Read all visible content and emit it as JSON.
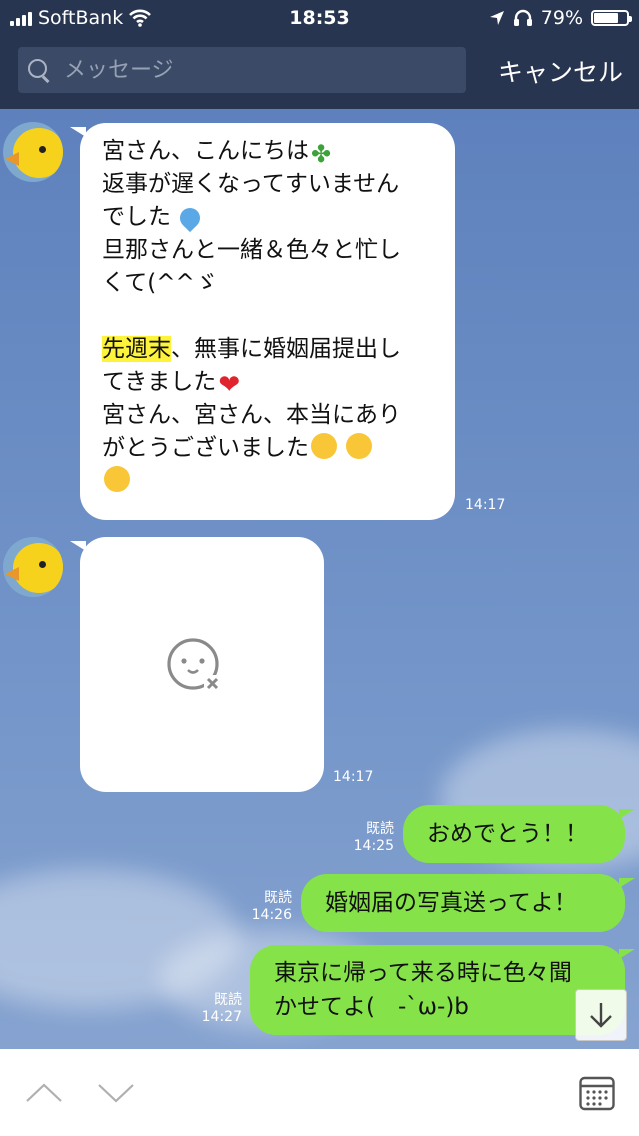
{
  "status": {
    "carrier": "SoftBank",
    "time": "18:53",
    "battery": "79%",
    "battery_level": 0.79
  },
  "search": {
    "placeholder": "メッセージ",
    "cancel_label": "キャンセル"
  },
  "messages": [
    {
      "side": "in",
      "lines": [
        "宮さん、こんにちは",
        "返事が遅くなってすいません",
        "でした",
        "旦那さんと一緒＆色々と忙し",
        "くて(^^ゞ",
        "",
        "先週末",
        "、無事に婚姻届提出し",
        "てきました",
        "宮さん、宮さん、本当にあり",
        "がとうございました"
      ],
      "time": "14:17"
    },
    {
      "side": "in",
      "type": "image-unavailable",
      "time": "14:17"
    },
    {
      "side": "out",
      "text": "おめでとう！！",
      "read": "既読",
      "time": "14:25"
    },
    {
      "side": "out",
      "text": "婚姻届の写真送ってよ！",
      "read": "既読",
      "time": "14:26"
    },
    {
      "side": "out",
      "line1": "東京に帰って来る時に色々聞",
      "line2": "かせてよ(　-`ω-)b",
      "read": "既読",
      "time": "14:27"
    }
  ],
  "colors": {
    "header": "#283550",
    "outgoing_bubble": "#85e249",
    "incoming_bubble": "#ffffff",
    "highlight": "#fef33b"
  },
  "icons": [
    "search-icon",
    "clover-icon",
    "droplet-icon",
    "heart-icon",
    "laughing-emoji-icon",
    "broken-image-icon",
    "arrow-down-icon",
    "chevron-up-icon",
    "chevron-down-icon",
    "calendar-icon"
  ]
}
